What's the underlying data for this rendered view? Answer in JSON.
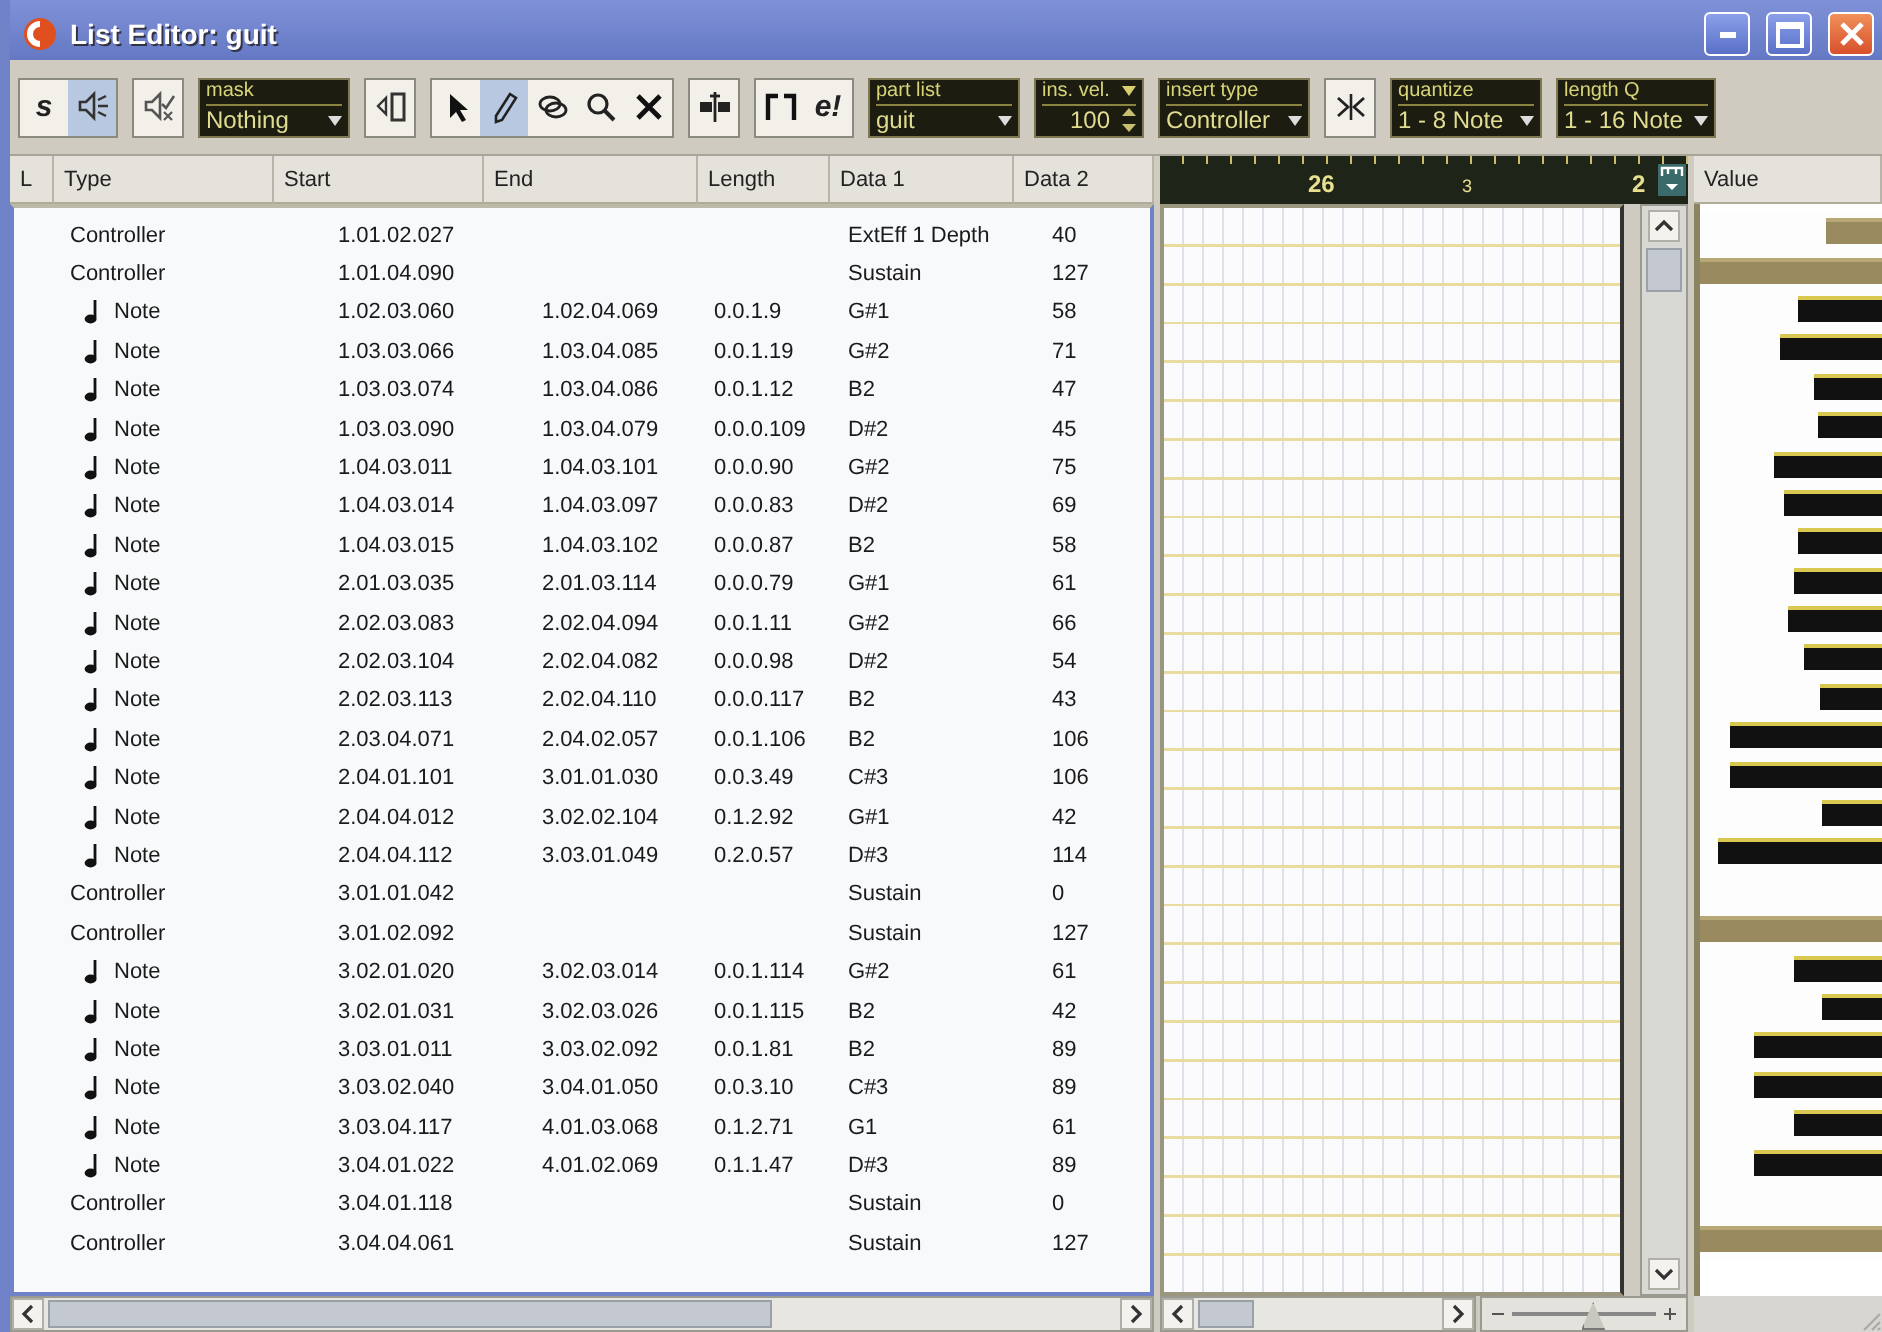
{
  "window": {
    "title": "List Editor: guit"
  },
  "toolbar": [
    {
      "kind": "buttons",
      "buttons": [
        {
          "text": "s",
          "selected": false
        },
        {
          "selected": true
        }
      ]
    },
    {
      "kind": "buttons",
      "buttons": [
        {
          "selected": false
        }
      ]
    },
    {
      "kind": "dropdown",
      "label": "mask",
      "value": "Nothing"
    },
    {
      "kind": "buttons",
      "buttons": [
        {
          "selected": false
        }
      ]
    },
    {
      "kind": "buttons",
      "buttons": [
        {
          "selected": false
        },
        {
          "selected": true
        },
        {
          "selected": false
        },
        {
          "selected": false
        },
        {
          "selected": false
        }
      ]
    },
    {
      "kind": "buttons",
      "buttons": [
        {
          "selected": false
        }
      ]
    },
    {
      "kind": "buttons",
      "buttons": [
        {
          "selected": false
        },
        {
          "text": "e!",
          "selected": false
        }
      ]
    },
    {
      "kind": "dropdown",
      "label": "part list",
      "value": "guit"
    },
    {
      "kind": "spinner",
      "label": "ins. vel.",
      "value": "100"
    },
    {
      "kind": "dropdown",
      "label": "insert type",
      "value": "Controller"
    },
    {
      "kind": "buttons",
      "buttons": [
        {
          "selected": false
        }
      ]
    },
    {
      "kind": "dropdown",
      "label": "quantize",
      "value": "1 - 8 Note"
    },
    {
      "kind": "dropdown",
      "label": "length Q",
      "value": "1 - 16 Note"
    }
  ],
  "table": {
    "columns": [
      "L",
      "Type",
      "Start",
      "End",
      "Length",
      "Data 1",
      "Data 2"
    ],
    "rows": [
      {
        "kind": "controller",
        "type": "Controller",
        "start": "1.01.02.027",
        "data1": "ExtEff 1 Depth",
        "data2": "40",
        "level": 0.31
      },
      {
        "kind": "controller",
        "type": "Controller",
        "start": "1.01.04.090",
        "data1": "Sustain",
        "data2": "127",
        "level": 1
      },
      {
        "kind": "note",
        "type": "Note",
        "start": "1.02.03.060",
        "end": "1.02.04.069",
        "length": "0.0.1.9",
        "data1": "G#1",
        "data2": "58",
        "level": 0.46
      },
      {
        "kind": "note",
        "type": "Note",
        "start": "1.03.03.066",
        "end": "1.03.04.085",
        "length": "0.0.1.19",
        "data1": "G#2",
        "data2": "71",
        "level": 0.56
      },
      {
        "kind": "note",
        "type": "Note",
        "start": "1.03.03.074",
        "end": "1.03.04.086",
        "length": "0.0.1.12",
        "data1": "B2",
        "data2": "47",
        "level": 0.37
      },
      {
        "kind": "note",
        "type": "Note",
        "start": "1.03.03.090",
        "end": "1.03.04.079",
        "length": "0.0.0.109",
        "data1": "D#2",
        "data2": "45",
        "level": 0.35
      },
      {
        "kind": "note",
        "type": "Note",
        "start": "1.04.03.011",
        "end": "1.04.03.101",
        "length": "0.0.0.90",
        "data1": "G#2",
        "data2": "75",
        "level": 0.59
      },
      {
        "kind": "note",
        "type": "Note",
        "start": "1.04.03.014",
        "end": "1.04.03.097",
        "length": "0.0.0.83",
        "data1": "D#2",
        "data2": "69",
        "level": 0.54
      },
      {
        "kind": "note",
        "type": "Note",
        "start": "1.04.03.015",
        "end": "1.04.03.102",
        "length": "0.0.0.87",
        "data1": "B2",
        "data2": "58",
        "level": 0.46
      },
      {
        "kind": "note",
        "type": "Note",
        "start": "2.01.03.035",
        "end": "2.01.03.114",
        "length": "0.0.0.79",
        "data1": "G#1",
        "data2": "61",
        "level": 0.48
      },
      {
        "kind": "note",
        "type": "Note",
        "start": "2.02.03.083",
        "end": "2.02.04.094",
        "length": "0.0.1.11",
        "data1": "G#2",
        "data2": "66",
        "level": 0.52
      },
      {
        "kind": "note",
        "type": "Note",
        "start": "2.02.03.104",
        "end": "2.02.04.082",
        "length": "0.0.0.98",
        "data1": "D#2",
        "data2": "54",
        "level": 0.43
      },
      {
        "kind": "note",
        "type": "Note",
        "start": "2.02.03.113",
        "end": "2.02.04.110",
        "length": "0.0.0.117",
        "data1": "B2",
        "data2": "43",
        "level": 0.34
      },
      {
        "kind": "note",
        "type": "Note",
        "start": "2.03.04.071",
        "end": "2.04.02.057",
        "length": "0.0.1.106",
        "data1": "B2",
        "data2": "106",
        "level": 0.83
      },
      {
        "kind": "note",
        "type": "Note",
        "start": "2.04.01.101",
        "end": "3.01.01.030",
        "length": "0.0.3.49",
        "data1": "C#3",
        "data2": "106",
        "level": 0.83
      },
      {
        "kind": "note",
        "type": "Note",
        "start": "2.04.04.012",
        "end": "3.02.02.104",
        "length": "0.1.2.92",
        "data1": "G#1",
        "data2": "42",
        "level": 0.33
      },
      {
        "kind": "note",
        "type": "Note",
        "start": "2.04.04.112",
        "end": "3.03.01.049",
        "length": "0.2.0.57",
        "data1": "D#3",
        "data2": "114",
        "level": 0.9
      },
      {
        "kind": "controller",
        "type": "Controller",
        "start": "3.01.01.042",
        "data1": "Sustain",
        "data2": "0"
      },
      {
        "kind": "controller",
        "type": "Controller",
        "start": "3.01.02.092",
        "data1": "Sustain",
        "data2": "127",
        "level": 1
      },
      {
        "kind": "note",
        "type": "Note",
        "start": "3.02.01.020",
        "end": "3.02.03.014",
        "length": "0.0.1.114",
        "data1": "G#2",
        "data2": "61",
        "level": 0.48
      },
      {
        "kind": "note",
        "type": "Note",
        "start": "3.02.01.031",
        "end": "3.02.03.026",
        "length": "0.0.1.115",
        "data1": "B2",
        "data2": "42",
        "level": 0.33
      },
      {
        "kind": "note",
        "type": "Note",
        "start": "3.03.01.011",
        "end": "3.03.02.092",
        "length": "0.0.1.81",
        "data1": "B2",
        "data2": "89",
        "level": 0.7
      },
      {
        "kind": "note",
        "type": "Note",
        "start": "3.03.02.040",
        "end": "3.04.01.050",
        "length": "0.0.3.10",
        "data1": "C#3",
        "data2": "89",
        "level": 0.7
      },
      {
        "kind": "note",
        "type": "Note",
        "start": "3.03.04.117",
        "end": "4.01.03.068",
        "length": "0.1.2.71",
        "data1": "G1",
        "data2": "61",
        "level": 0.48
      },
      {
        "kind": "note",
        "type": "Note",
        "start": "3.04.01.022",
        "end": "4.01.02.069",
        "length": "0.1.1.47",
        "data1": "D#3",
        "data2": "89",
        "level": 0.7
      },
      {
        "kind": "controller",
        "type": "Controller",
        "start": "3.04.01.118",
        "data1": "Sustain",
        "data2": "0"
      },
      {
        "kind": "controller",
        "type": "Controller",
        "start": "3.04.04.061",
        "data1": "Sustain",
        "data2": "127",
        "level": 1
      }
    ]
  },
  "grid": {
    "ruler": [
      "26",
      "3",
      "2"
    ],
    "zoom": {
      "level": 0.55
    }
  },
  "value_column": {
    "title": "Value"
  }
}
